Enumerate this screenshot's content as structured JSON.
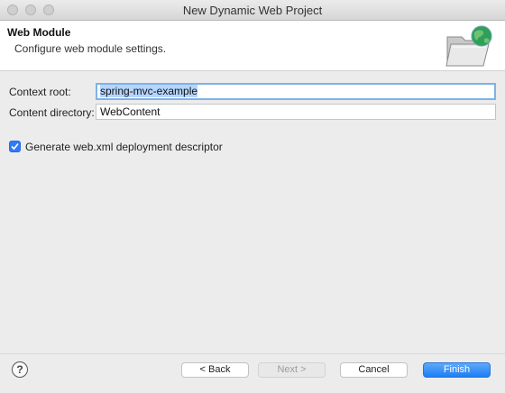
{
  "window": {
    "title": "New Dynamic Web Project"
  },
  "header": {
    "title": "Web Module",
    "description": "Configure web module settings.",
    "icon": "folder-globe-icon"
  },
  "form": {
    "context_root_label": "Context root:",
    "context_root_value": "spring-mvc-example",
    "content_dir_label": "Content directory:",
    "content_dir_value": "WebContent",
    "generate_label": "Generate web.xml deployment descriptor",
    "generate_checked": true
  },
  "footer": {
    "help_label": "?",
    "back_label": "< Back",
    "next_label": "Next >",
    "cancel_label": "Cancel",
    "finish_label": "Finish"
  },
  "colors": {
    "accent": "#1d7ef4",
    "selection": "#b5d5ff"
  }
}
